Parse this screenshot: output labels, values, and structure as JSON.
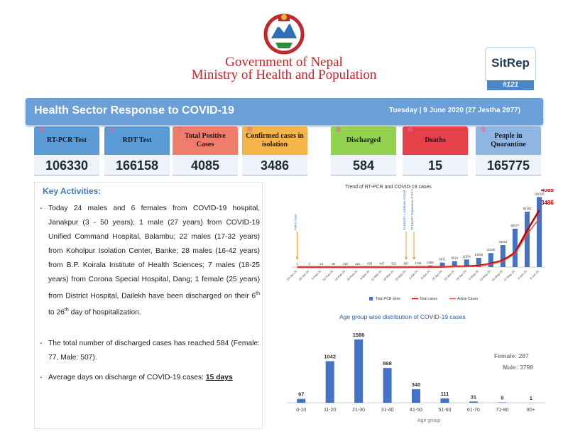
{
  "header": {
    "government": "Government of Nepal",
    "ministry": "Ministry of Health and Population",
    "sitrep_label": "SitRep",
    "sitrep_number": "#121"
  },
  "banner": {
    "title": "Health Sector Response to COVID-19",
    "date": "Tuesday | 9 June 2020 (27 Jestha 2077)"
  },
  "stats": [
    {
      "label": "RT-PCR Test",
      "value": "106330",
      "color": "#5b9bd5"
    },
    {
      "label": "RDT Test",
      "value": "166158",
      "color": "#5b9bd5"
    },
    {
      "label": "Total Positive Cases",
      "value": "4085",
      "color": "#f07c6c"
    },
    {
      "label": "Confirmed cases in isolation",
      "value": "3486",
      "color": "#f5b54a"
    },
    {
      "label": "Discharged",
      "value": "584",
      "color": "#92d050"
    },
    {
      "label": "Deaths",
      "value": "15",
      "color": "#e6404a"
    },
    {
      "label": "People in Quarantine",
      "value": "165775",
      "color": "#8fb6e2"
    }
  ],
  "key_activities": {
    "title": "Key Activities:",
    "items": [
      "Today 24 males and 6 females from COVID-19 hospital, Janakpur (3 - 50 years); 1 male (27 years) from COVID-19 Unified Command Hospital, Balambu; 22 males (17-32 years) from Koholpur Isolation Center, Banke; 28 males (16-42 years) from B.P. Koirala Institute of Health Sciences; 7 males (18-25 years) from Corona Special Hospital, Dang; 1 female (25 years) from District Hospital, Dailekh have been discharged on their 6th to 26th day of hospitalization.",
      "The total number of discharged cases has reached 584 (Female: 77, Male: 507).",
      "Average days on discharge of COVID-19 cases: "
    ],
    "avg_days": "15 days"
  },
  "chart_data": [
    {
      "type": "bar",
      "title": "Trend of RT-PCR and COVID-19 cases",
      "categories": [
        "23-Jan-20",
        "29-Jan-20",
        "5-Feb-20",
        "12-Feb-20",
        "19-Feb-20",
        "26-Feb-20",
        "4-Mar-20",
        "11-Mar-20",
        "18-Mar-20",
        "25-Mar-20",
        "1-Apr-20",
        "8-Apr-20",
        "15-Apr-20",
        "22-Apr-20",
        "29-Apr-20",
        "6-May-20",
        "13-May-20",
        "20-May-20",
        "27-May-20",
        "3-Jun-20",
        "9-Jun-20"
      ],
      "series": [
        {
          "name": "Total PCR done",
          "values": [
            1,
            4,
            14,
            20,
            210,
            221,
            433,
            447,
            512,
            687,
            1145,
            2366,
            6871,
            9014,
            11524,
            14096,
            21340,
            33494,
            58277,
            84153,
            106330
          ],
          "color": "#4472c4"
        },
        {
          "name": "Total cases",
          "values": [
            1,
            1,
            1,
            1,
            1,
            1,
            1,
            1,
            1,
            2,
            5,
            9,
            16,
            48,
            57,
            101,
            249,
            487,
            1042,
            2634,
            4085
          ],
          "color": "#c00000"
        },
        {
          "name": "Active Cases",
          "values": [
            0,
            0,
            0,
            0,
            0,
            0,
            0,
            0,
            0,
            2,
            5,
            8,
            12,
            31,
            41,
            70,
            211,
            433,
            960,
            2370,
            3486
          ],
          "color": "#e74c3c"
        }
      ],
      "annotations": [
        "Index Case",
        "24 March: Lockdown started",
        "29 March: Expansion of RT-PCR Lab"
      ],
      "end_labels": [
        "4085",
        "3486"
      ]
    },
    {
      "type": "bar",
      "title": "Age group wise distribution of COVID-19 cases",
      "categories": [
        "0-10",
        "11-20",
        "21-30",
        "31-40",
        "41-50",
        "51-60",
        "61-70",
        "71-80",
        "80+"
      ],
      "values": [
        97,
        1042,
        1586,
        868,
        340,
        111,
        31,
        9,
        1
      ],
      "xlabel": "Age group",
      "color": "#4472c4",
      "female_label": "Female:",
      "female_value": "287",
      "male_label": "Male:",
      "male_value": "3798"
    }
  ]
}
